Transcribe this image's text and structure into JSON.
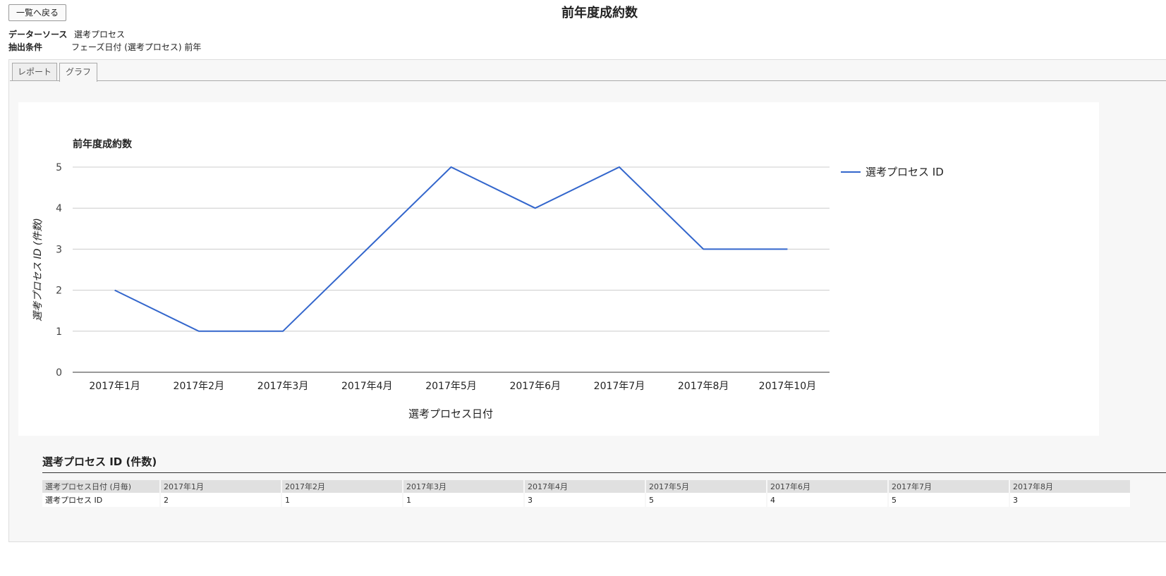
{
  "back_button": "一覧へ戻る",
  "page_title": "前年度成約数",
  "meta": {
    "datasource_label": "データーソース",
    "datasource_value": "選考プロセス",
    "filter_label": "抽出条件",
    "filter_value": "フェーズ日付 (選考プロセス) 前年"
  },
  "tabs": [
    {
      "label": "レポート",
      "active": false
    },
    {
      "label": "グラフ",
      "active": true
    }
  ],
  "chart_data": {
    "type": "line",
    "title": "前年度成約数",
    "xlabel": "選考プロセス日付",
    "ylabel": "選考プロセス ID (件数)",
    "categories": [
      "2017年1月",
      "2017年2月",
      "2017年3月",
      "2017年4月",
      "2017年5月",
      "2017年6月",
      "2017年7月",
      "2017年8月",
      "2017年10月"
    ],
    "series": [
      {
        "name": "選考プロセス ID",
        "values": [
          2,
          1,
          1,
          3,
          5,
          4,
          5,
          3,
          3
        ],
        "color": "#3366cc"
      }
    ],
    "ylim": [
      0,
      5
    ],
    "yticks": [
      0,
      1,
      2,
      3,
      4,
      5
    ],
    "grid": true,
    "legend": "right"
  },
  "table": {
    "title": "選考プロセス ID (件数)",
    "header_label": "選考プロセス日付 (月毎)",
    "columns": [
      "2017年1月",
      "2017年2月",
      "2017年3月",
      "2017年4月",
      "2017年5月",
      "2017年6月",
      "2017年7月",
      "2017年8月"
    ],
    "row_label": "選考プロセス ID",
    "values": [
      "2",
      "1",
      "1",
      "3",
      "5",
      "4",
      "5",
      "3"
    ]
  }
}
